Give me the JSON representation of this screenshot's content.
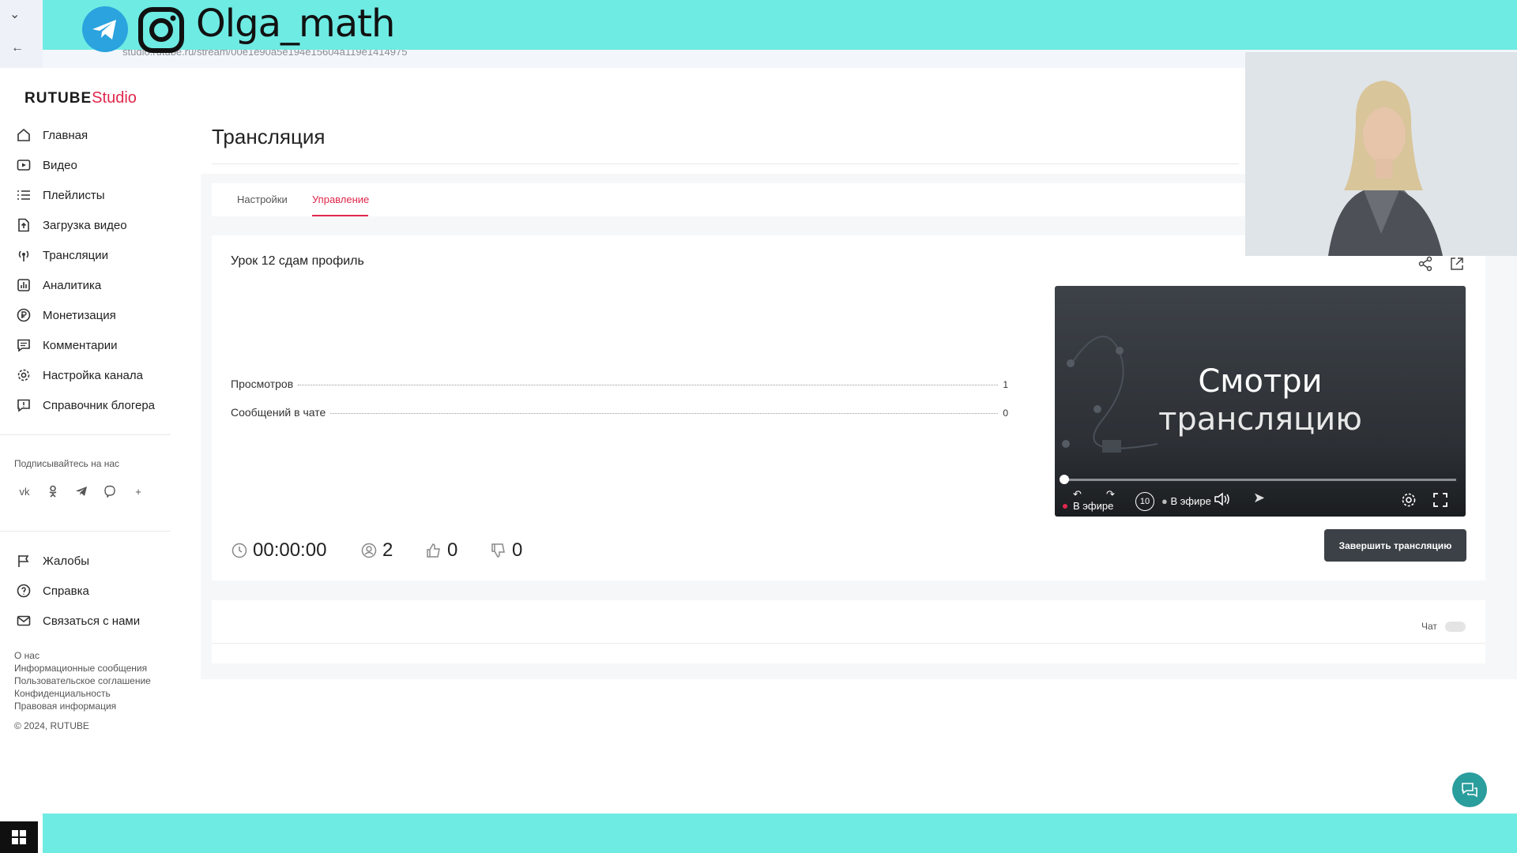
{
  "overlay": {
    "brand": "Olga_math"
  },
  "browser": {
    "url": "studio.rutube.ru/stream/00e1e90a5e194e15604a119e1414975"
  },
  "logo": {
    "main": "RUTUBE",
    "studio": "Studio"
  },
  "sidebar": {
    "items": [
      {
        "label": "Главная",
        "icon": "home-icon"
      },
      {
        "label": "Видео",
        "icon": "video-icon"
      },
      {
        "label": "Плейлисты",
        "icon": "playlist-icon"
      },
      {
        "label": "Загрузка видео",
        "icon": "upload-icon"
      },
      {
        "label": "Трансляции",
        "icon": "broadcast-icon"
      },
      {
        "label": "Аналитика",
        "icon": "analytics-icon"
      },
      {
        "label": "Монетизация",
        "icon": "ruble-icon"
      },
      {
        "label": "Комментарии",
        "icon": "comment-icon"
      },
      {
        "label": "Настройка канала",
        "icon": "gear-icon"
      },
      {
        "label": "Справочник блогера",
        "icon": "guide-icon"
      }
    ],
    "subscribe_label": "Подписывайтесь на нас",
    "socials": [
      "vk-icon",
      "ok-icon",
      "telegram-icon",
      "viber-icon",
      "plus-icon"
    ],
    "secondary": [
      {
        "label": "Жалобы",
        "icon": "flag-icon"
      },
      {
        "label": "Справка",
        "icon": "help-icon"
      },
      {
        "label": "Связаться с нами",
        "icon": "mail-icon"
      }
    ],
    "footer_links": [
      "О нас",
      "Информационные сообщения",
      "Пользовательское соглашение",
      "Конфиденциальность",
      "Правовая информация"
    ],
    "copyright": "© 2024, RUTUBE"
  },
  "page": {
    "title": "Трансляция",
    "tabs": [
      "Настройки",
      "Управление"
    ],
    "active_tab": 1
  },
  "stream": {
    "title": "Урок 12 сдам профиль",
    "stats": [
      {
        "label": "Просмотров",
        "value": "1"
      },
      {
        "label": "Сообщений в чате",
        "value": "0"
      }
    ],
    "timer": "00:00:00",
    "viewers": "2",
    "likes": "0",
    "dislikes": "0",
    "end_button": "Завершить трансляцию"
  },
  "player": {
    "line1": "Смотри",
    "line2": "трансляцию",
    "live_label": "В эфире",
    "live_label2": "В эфире",
    "seek_label": "10"
  },
  "chat": {
    "label": "Чат"
  },
  "colors": {
    "accent": "#e0274c",
    "banner": "#6eebe3",
    "button": "#3c4147"
  }
}
